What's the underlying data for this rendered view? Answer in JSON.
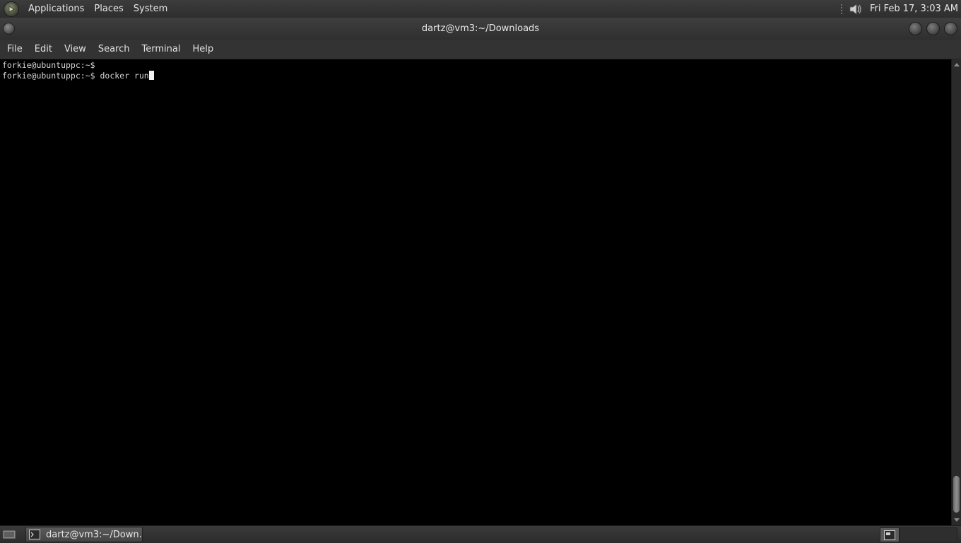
{
  "top_panel": {
    "menus": [
      "Applications",
      "Places",
      "System"
    ],
    "clock": "Fri Feb 17,  3:03 AM",
    "icons": [
      "distro-logo-icon",
      "volume-icon"
    ]
  },
  "window": {
    "title": "dartz@vm3:~/Downloads"
  },
  "menubar": {
    "items": [
      "File",
      "Edit",
      "View",
      "Search",
      "Terminal",
      "Help"
    ]
  },
  "terminal": {
    "lines": [
      "forkie@ubuntuppc:~$",
      "forkie@ubuntuppc:~$ docker run"
    ]
  },
  "taskbar": {
    "task_label": "dartz@vm3:~/Down...",
    "icons": [
      "show-desktop-icon",
      "terminal-icon",
      "workspace-icon"
    ]
  },
  "colors": {
    "terminal_bg": "#000000",
    "terminal_fg": "#d4d4d4",
    "panel_bg": "#333333"
  }
}
